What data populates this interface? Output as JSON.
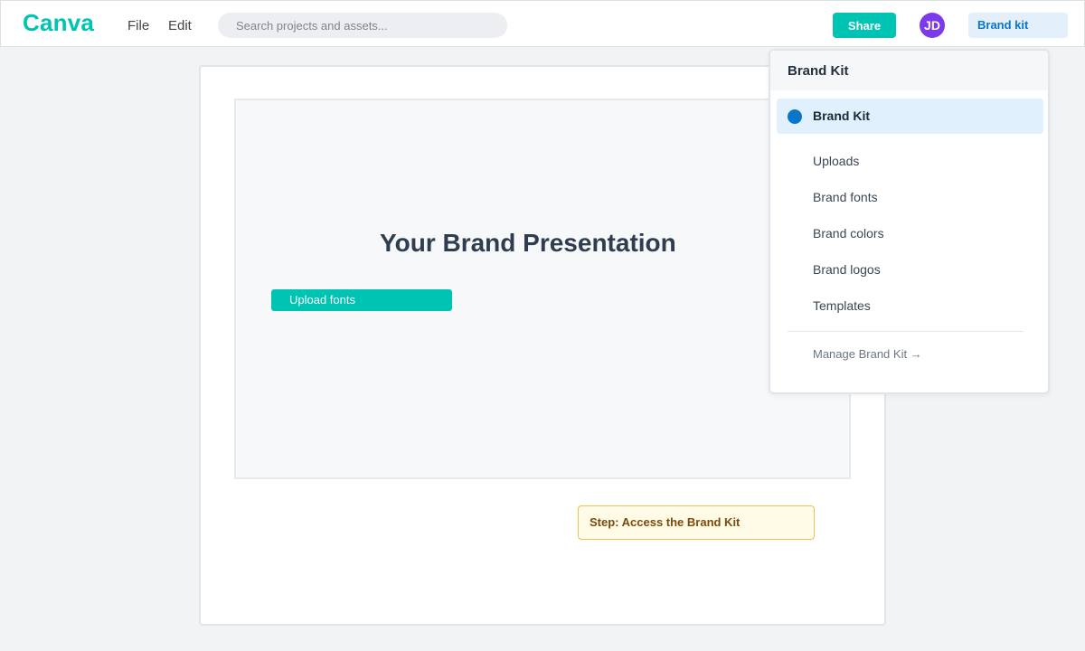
{
  "app": {
    "logo": "Canva"
  },
  "menu": {
    "file": "File",
    "edit": "Edit"
  },
  "search": {
    "placeholder": "Search projects and assets..."
  },
  "header": {
    "share_label": "Share",
    "avatar_initials": "JD",
    "brand_kit_label": "Brand kit"
  },
  "canvas": {
    "slide_title": "Your Brand Presentation",
    "upload_fonts_label": "Upload fonts",
    "step_note": "Step: Access the Brand Kit"
  },
  "dropdown": {
    "title": "Brand Kit",
    "active_item": "Brand Kit",
    "items": [
      "Uploads",
      "Brand fonts",
      "Brand colors",
      "Brand logos",
      "Templates"
    ],
    "manage_link": "Manage Brand Kit →"
  },
  "colors": {
    "brand": "#00c4b3",
    "accent_blue": "#0a75c9",
    "avatar": "#7c3aed",
    "note_bg": "#fffbe6"
  }
}
